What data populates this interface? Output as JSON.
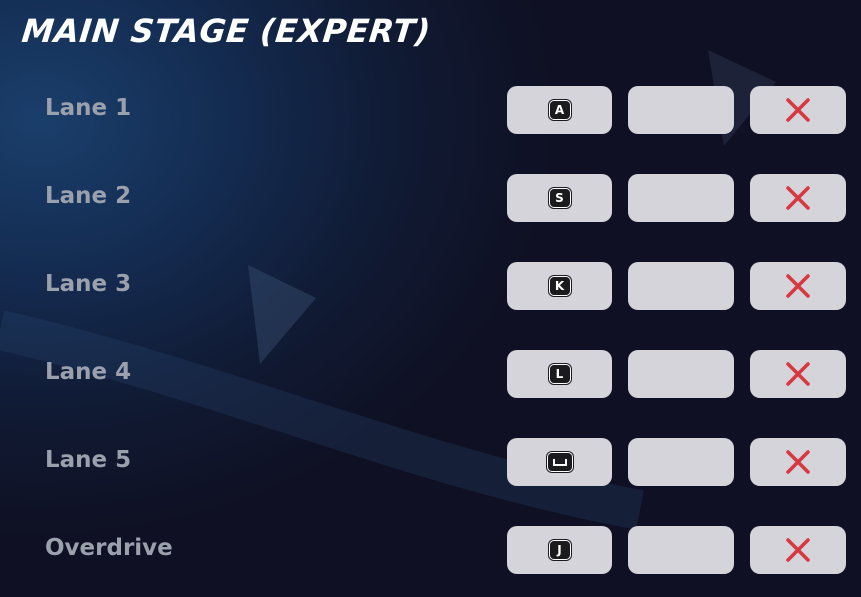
{
  "header": {
    "title": "MAIN STAGE (EXPERT)"
  },
  "rows": [
    {
      "label": "Lane 1",
      "key": "A"
    },
    {
      "label": "Lane 2",
      "key": "S"
    },
    {
      "label": "Lane 3",
      "key": "K"
    },
    {
      "label": "Lane 4",
      "key": "L"
    },
    {
      "label": "Lane 5",
      "key": "",
      "key_icon": "spacebar-icon"
    },
    {
      "label": "Overdrive",
      "key": "J"
    }
  ],
  "icons": {
    "clear": "close-icon"
  },
  "colors": {
    "title": "#ffffff",
    "label": "#9ba0ad",
    "button": "#d4d4da",
    "keycap": "#1b1b1f",
    "clear_x": "#d9363e"
  }
}
